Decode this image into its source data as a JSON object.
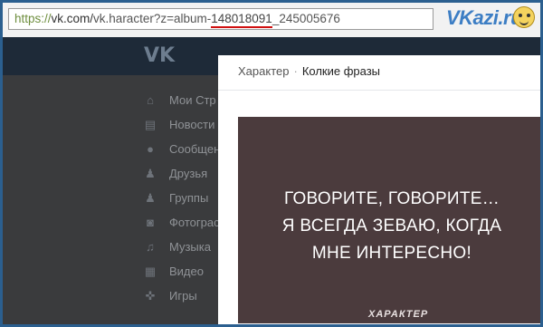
{
  "address_bar": {
    "scheme": "https://",
    "host": "vk.com/",
    "path": "vk.haracter?z=album-",
    "album_id": "148018091",
    "photo_tail": "_245005676"
  },
  "brand": {
    "name": "VKazi.ru"
  },
  "vk": {
    "logo": "VK",
    "menu": [
      {
        "label": "Мои Стр",
        "icon": "home-icon"
      },
      {
        "label": "Новости",
        "icon": "news-icon"
      },
      {
        "label": "Сообщен",
        "icon": "message-icon"
      },
      {
        "label": "Друзья",
        "icon": "friends-icon"
      },
      {
        "label": "Группы",
        "icon": "groups-icon"
      },
      {
        "label": "Фотограс",
        "icon": "camera-icon"
      },
      {
        "label": "Музыка",
        "icon": "music-icon"
      },
      {
        "label": "Видео",
        "icon": "video-icon"
      },
      {
        "label": "Игры",
        "icon": "games-icon"
      }
    ]
  },
  "modal": {
    "breadcrumb": {
      "group": "Характер",
      "separator": "·",
      "album": "Колкие фразы"
    },
    "photo": {
      "lines": [
        "ГОВОРИТЕ, ГОВОРИТЕ…",
        "Я ВСЕГДА ЗЕВАЮ, КОГДА",
        "МНЕ ИНТЕРЕСНО!"
      ],
      "watermark": "ХАРАКТЕР"
    }
  }
}
